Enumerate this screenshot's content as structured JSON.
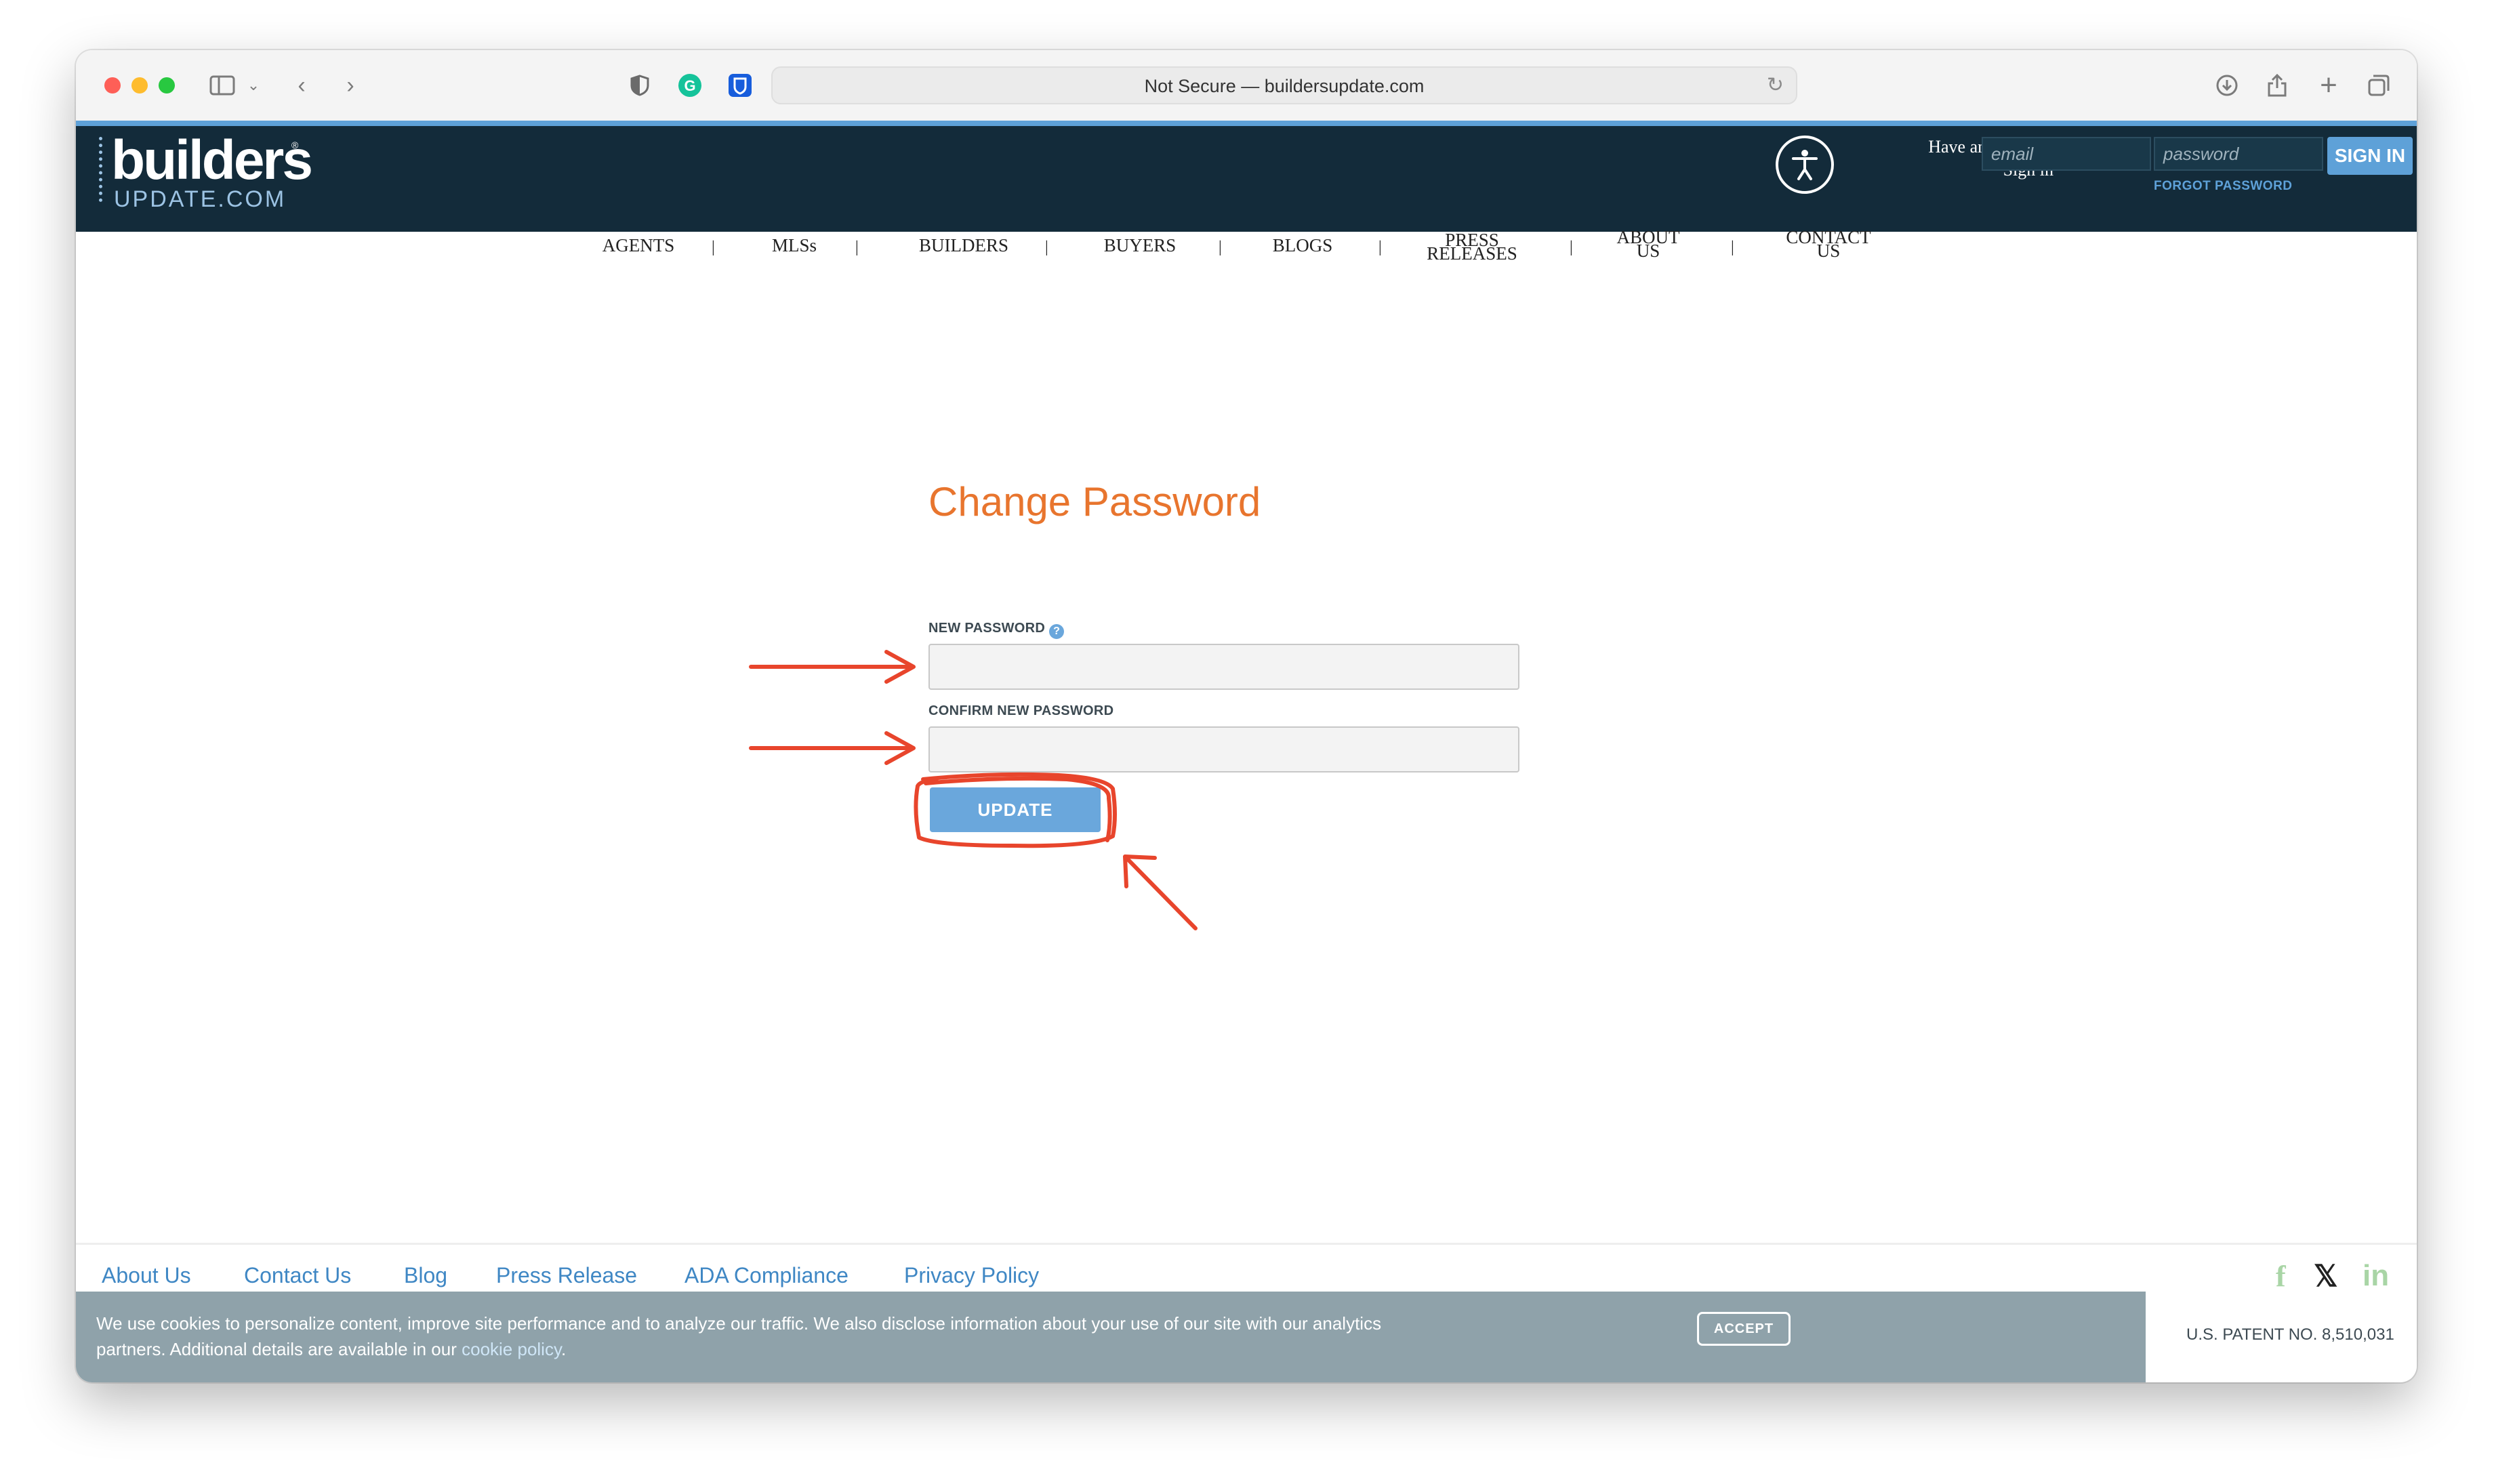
{
  "browser": {
    "address": "Not Secure — buildersupdate.com",
    "colors": {
      "close": "#fe5f57",
      "minimize": "#febc2e",
      "zoom": "#28c840"
    }
  },
  "header": {
    "logo_main": "builders",
    "logo_sub": "UPDATE.COM",
    "logo_reg": "®",
    "have_account": "Have an account?",
    "sign_in_text": "Sign in",
    "email_placeholder": "email",
    "password_placeholder": "password",
    "sign_in_button": "SIGN IN",
    "forgot_password": "FORGOT PASSWORD"
  },
  "nav": {
    "agents": "AGENTS",
    "mlss": "MLSs",
    "builders": "BUILDERS",
    "buyers": "BUYERS",
    "blogs": "BLOGS",
    "press_1": "PRESS",
    "press_2": "RELEASES",
    "about_1": "ABOUT",
    "about_2": "US",
    "contact_1": "CONTACT",
    "contact_2": "US",
    "separator": "|"
  },
  "form": {
    "title": "Change Password",
    "new_password_label": "NEW PASSWORD",
    "help_icon": "?",
    "confirm_label": "CONFIRM NEW PASSWORD",
    "update_button": "UPDATE",
    "accent_color": "#e8752e",
    "annotation_color": "#e8452c"
  },
  "footer": {
    "links": [
      "About Us",
      "Contact Us",
      "Blog",
      "Press Release",
      "ADA Compliance",
      "Privacy Policy"
    ],
    "social": {
      "facebook": "f",
      "x": "𝕏",
      "linkedin": "in"
    },
    "patent": "U.S. PATENT NO. 8,510,031"
  },
  "cookie": {
    "text": "We use cookies to personalize content, improve site performance and to analyze our traffic. We also disclose information about your use of our site with our analytics partners. Additional details are available in our ",
    "link": "cookie policy",
    "end": ".",
    "accept": "ACCEPT"
  }
}
